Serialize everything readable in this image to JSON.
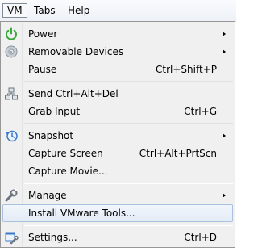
{
  "menubar": {
    "items": [
      {
        "label": "VM",
        "mnemonic": "V",
        "rest": "M"
      },
      {
        "label": "Tabs",
        "mnemonic": "T",
        "rest": "abs"
      },
      {
        "label": "Help",
        "mnemonic": "H",
        "rest": "elp"
      }
    ]
  },
  "menu": {
    "power": {
      "label": "Power",
      "icon": "power-icon"
    },
    "removable_devices": {
      "label": "Removable Devices",
      "icon": "disc-icon"
    },
    "pause": {
      "label": "Pause",
      "shortcut": "Ctrl+Shift+P"
    },
    "send_ctrl_alt_del": {
      "label": "Send Ctrl+Alt+Del",
      "icon": "network-icon"
    },
    "grab_input": {
      "label": "Grab Input",
      "shortcut": "Ctrl+G"
    },
    "snapshot": {
      "label": "Snapshot",
      "icon": "snapshot-icon"
    },
    "capture_screen": {
      "label": "Capture Screen",
      "shortcut": "Ctrl+Alt+PrtScn"
    },
    "capture_movie": {
      "label": "Capture Movie..."
    },
    "manage": {
      "label": "Manage",
      "icon": "wrench-icon"
    },
    "install_tools": {
      "label": "Install VMware Tools..."
    },
    "settings": {
      "label": "Settings...",
      "shortcut": "Ctrl+D",
      "icon": "settings-icon"
    }
  },
  "colors": {
    "menu_bg": "#f0f0f0",
    "highlight_border": "#a9c0de",
    "power_green": "#3aa83a",
    "icon_blue": "#3c78c8"
  }
}
